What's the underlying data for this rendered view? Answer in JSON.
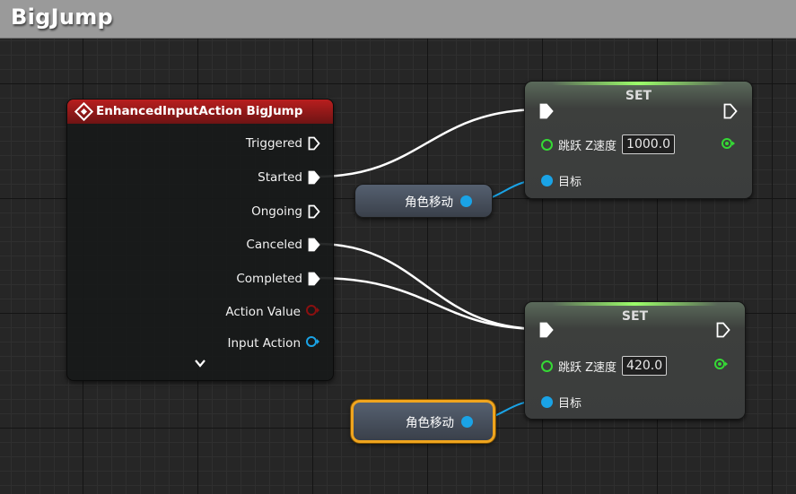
{
  "graph": {
    "title": "BigJump"
  },
  "event_node": {
    "title": "EnhancedInputAction BigJump",
    "header_color": "#b81e1e",
    "pins": [
      {
        "label": "Triggered",
        "kind": "exec",
        "connected": false
      },
      {
        "label": "Started",
        "kind": "exec",
        "connected": true
      },
      {
        "label": "Ongoing",
        "kind": "exec",
        "connected": false
      },
      {
        "label": "Canceled",
        "kind": "exec",
        "connected": true
      },
      {
        "label": "Completed",
        "kind": "exec",
        "connected": true
      },
      {
        "label": "Action Value",
        "kind": "data",
        "color": "#8a1010"
      },
      {
        "label": "Input Action",
        "kind": "data",
        "color": "#1aa3e6"
      }
    ]
  },
  "set_nodes": [
    {
      "title": "SET",
      "variable_label": "跳跃 Z速度",
      "value": "1000.0",
      "target_label": "目标"
    },
    {
      "title": "SET",
      "variable_label": "跳跃 Z速度",
      "value": "420.0",
      "target_label": "目标"
    }
  ],
  "get_nodes": [
    {
      "label": "角色移动",
      "selected": false
    },
    {
      "label": "角色移动",
      "selected": true
    }
  ],
  "colors": {
    "exec": "#ffffff",
    "object_pin": "#1aa3e6",
    "bool_pin": "#35d935",
    "selection": "#f0a51e"
  }
}
